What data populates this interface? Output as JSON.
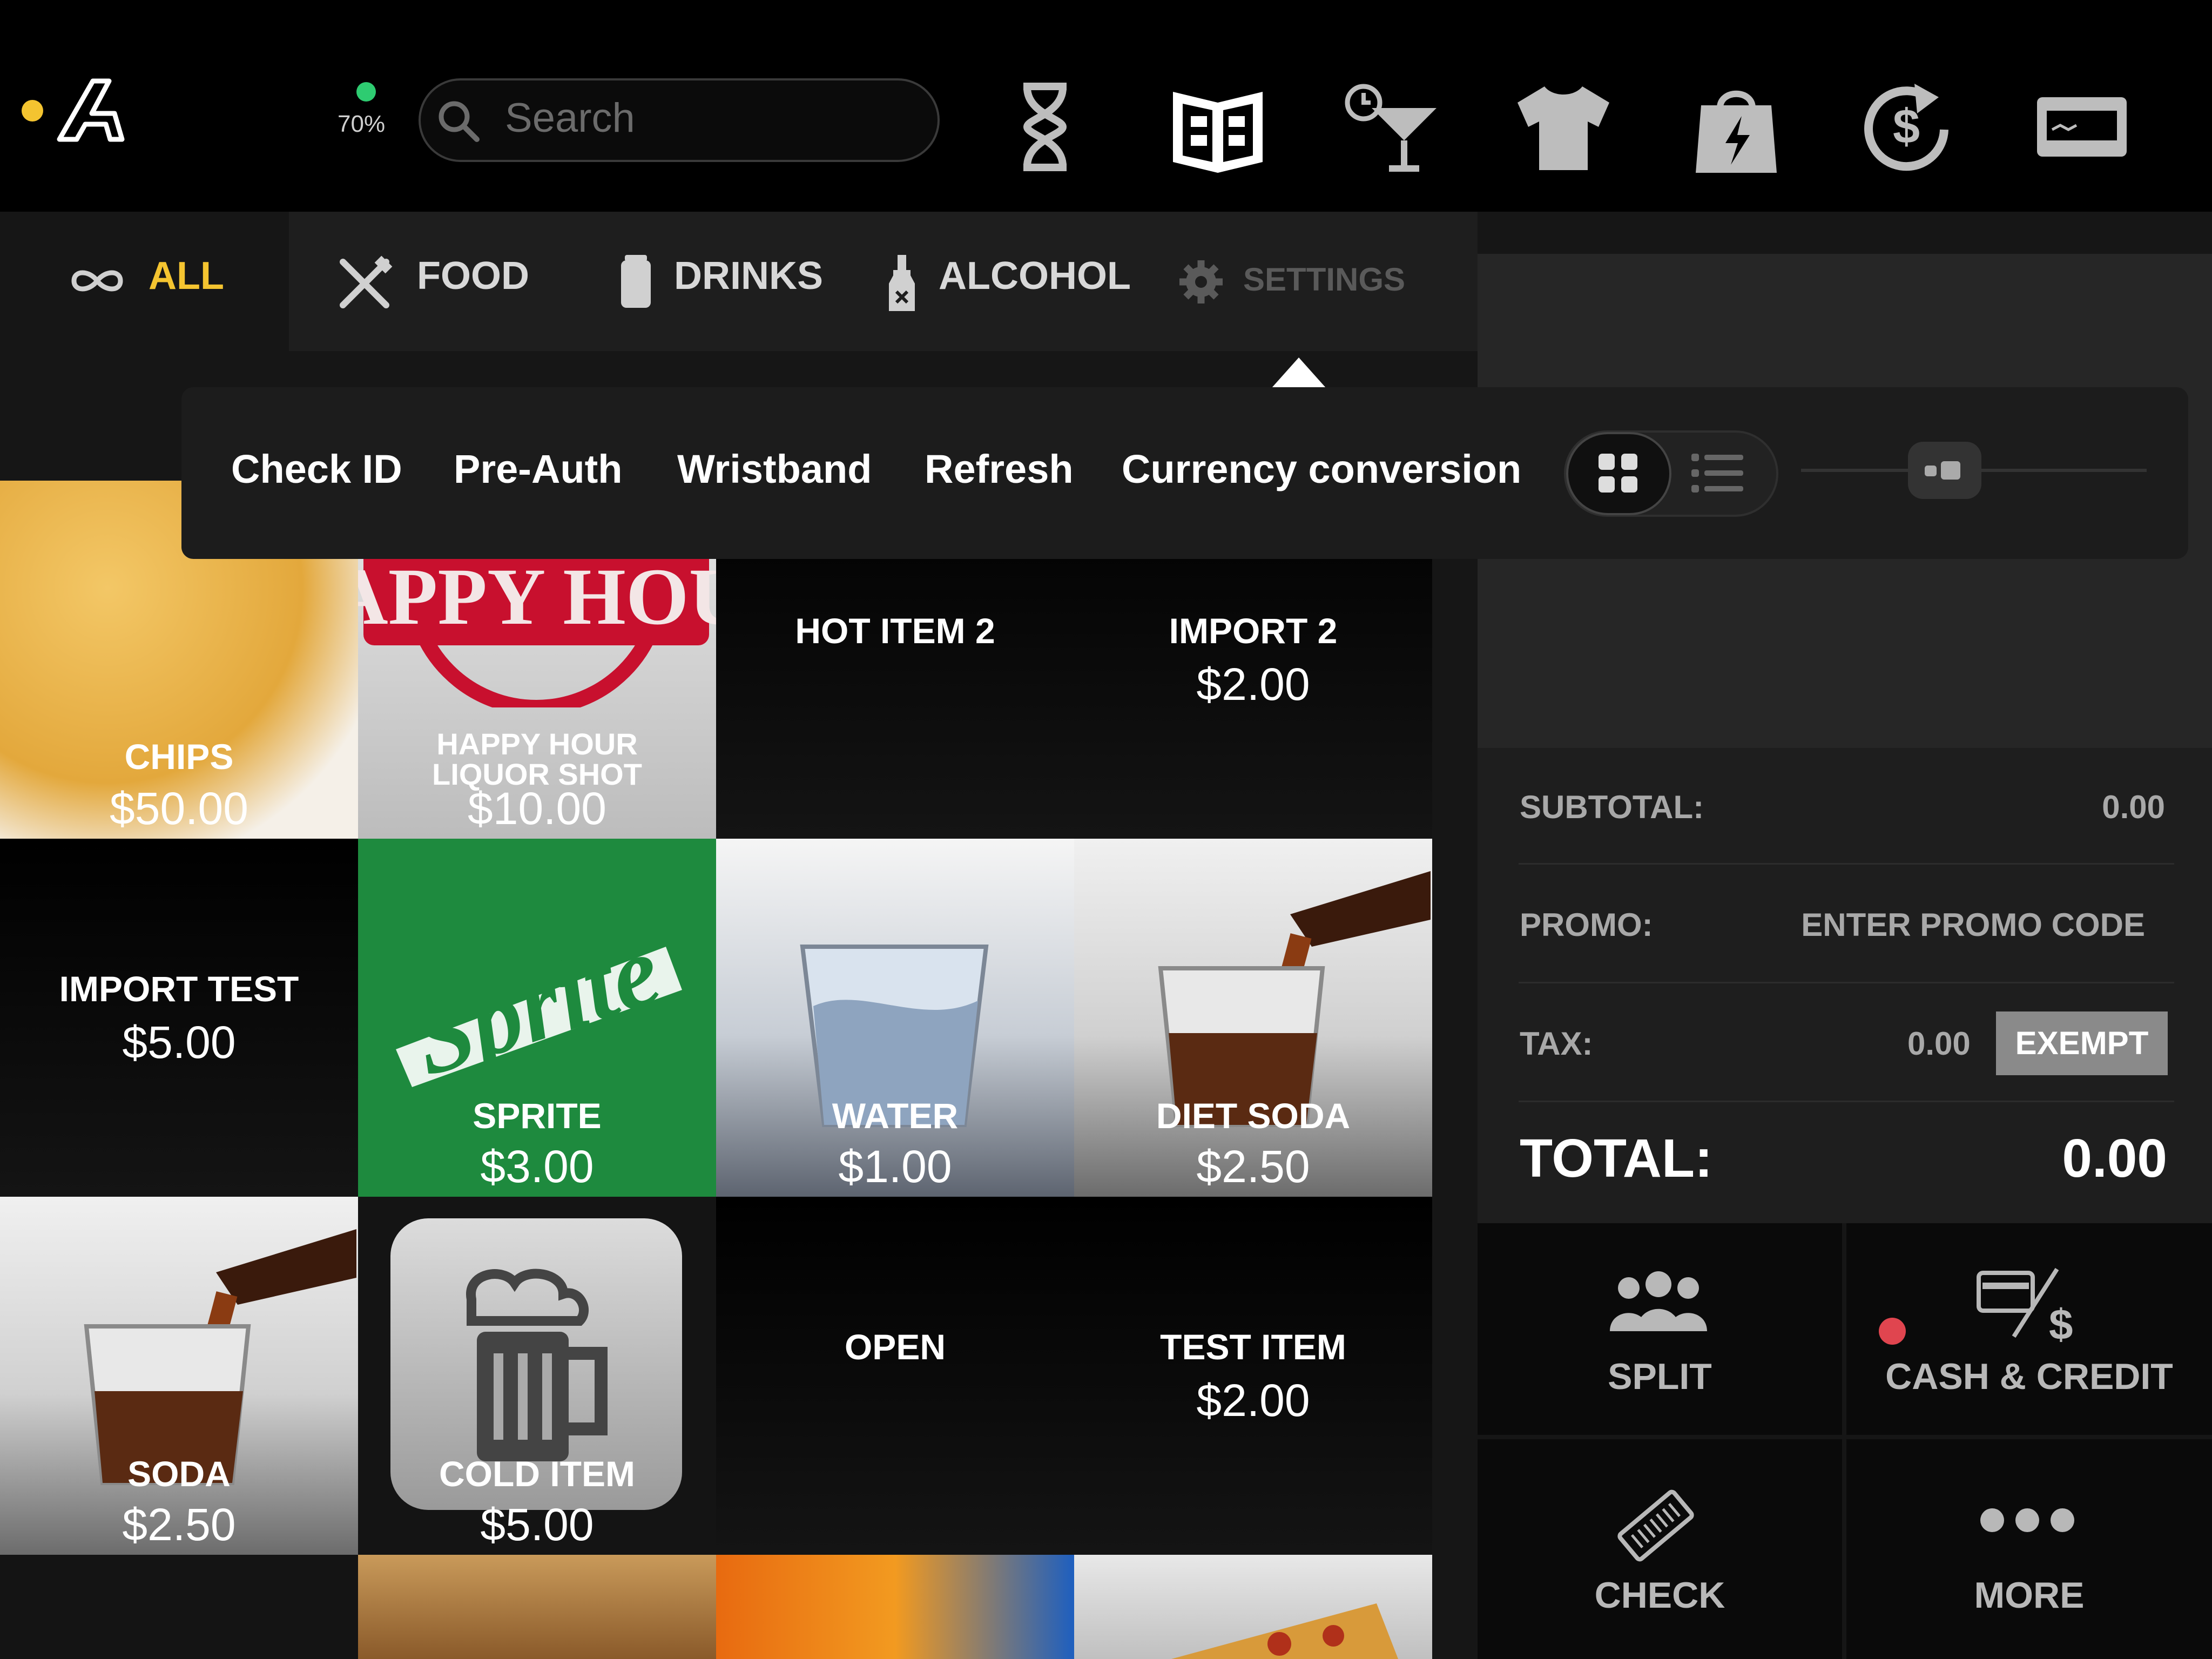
{
  "status": {
    "battery": "70%"
  },
  "search": {
    "placeholder": "Search"
  },
  "top_icons": [
    "hourglass-icon",
    "menu-book-icon",
    "happy-hour-cocktail-icon",
    "tshirt-icon",
    "shopping-bag-icon",
    "refund-icon",
    "card-icon"
  ],
  "categories": {
    "all": "ALL",
    "food": "FOOD",
    "drinks": "DRINKS",
    "alcohol": "ALCOHOL",
    "settings": "SETTINGS"
  },
  "popover": {
    "items": [
      "Check ID",
      "Pre-Auth",
      "Wristband",
      "Refresh",
      "Currency conversion"
    ],
    "view_mode": "grid"
  },
  "tiles": [
    {
      "name": "CHIPS",
      "price": "$50.00"
    },
    {
      "name": "HAPPY HOUR LIQUOR SHOT",
      "price": "$10.00",
      "stamp": "HAPPY HOUR"
    },
    {
      "name": "HOT ITEM 2",
      "price": ""
    },
    {
      "name": "IMPORT 2",
      "price": "$2.00"
    },
    {
      "name": "IMPORT TEST",
      "price": "$5.00"
    },
    {
      "name": "SPRITE",
      "price": "$3.00",
      "logo": "Sprite"
    },
    {
      "name": "WATER",
      "price": "$1.00"
    },
    {
      "name": "DIET SODA",
      "price": "$2.50"
    },
    {
      "name": "SODA",
      "price": "$2.50"
    },
    {
      "name": "COLD ITEM",
      "price": "$5.00"
    },
    {
      "name": "OPEN",
      "price": ""
    },
    {
      "name": "TEST ITEM",
      "price": "$2.00"
    }
  ],
  "summary": {
    "subtotal_label": "SUBTOTAL:",
    "subtotal_value": "0.00",
    "promo_label": "PROMO:",
    "promo_value": "ENTER PROMO CODE",
    "tax_label": "TAX:",
    "tax_value": "0.00",
    "exempt_label": "EXEMPT",
    "total_label": "TOTAL:",
    "total_value": "0.00"
  },
  "actions": {
    "split": "SPLIT",
    "cash_credit": "CASH & CREDIT",
    "check": "CHECK",
    "more": "MORE"
  },
  "colors": {
    "accent": "#f4c430",
    "battery": "#2ecc71",
    "sprite_green": "#1e8a3e",
    "stamp_red": "#c8102e",
    "alert_dot": "#e0454f"
  }
}
